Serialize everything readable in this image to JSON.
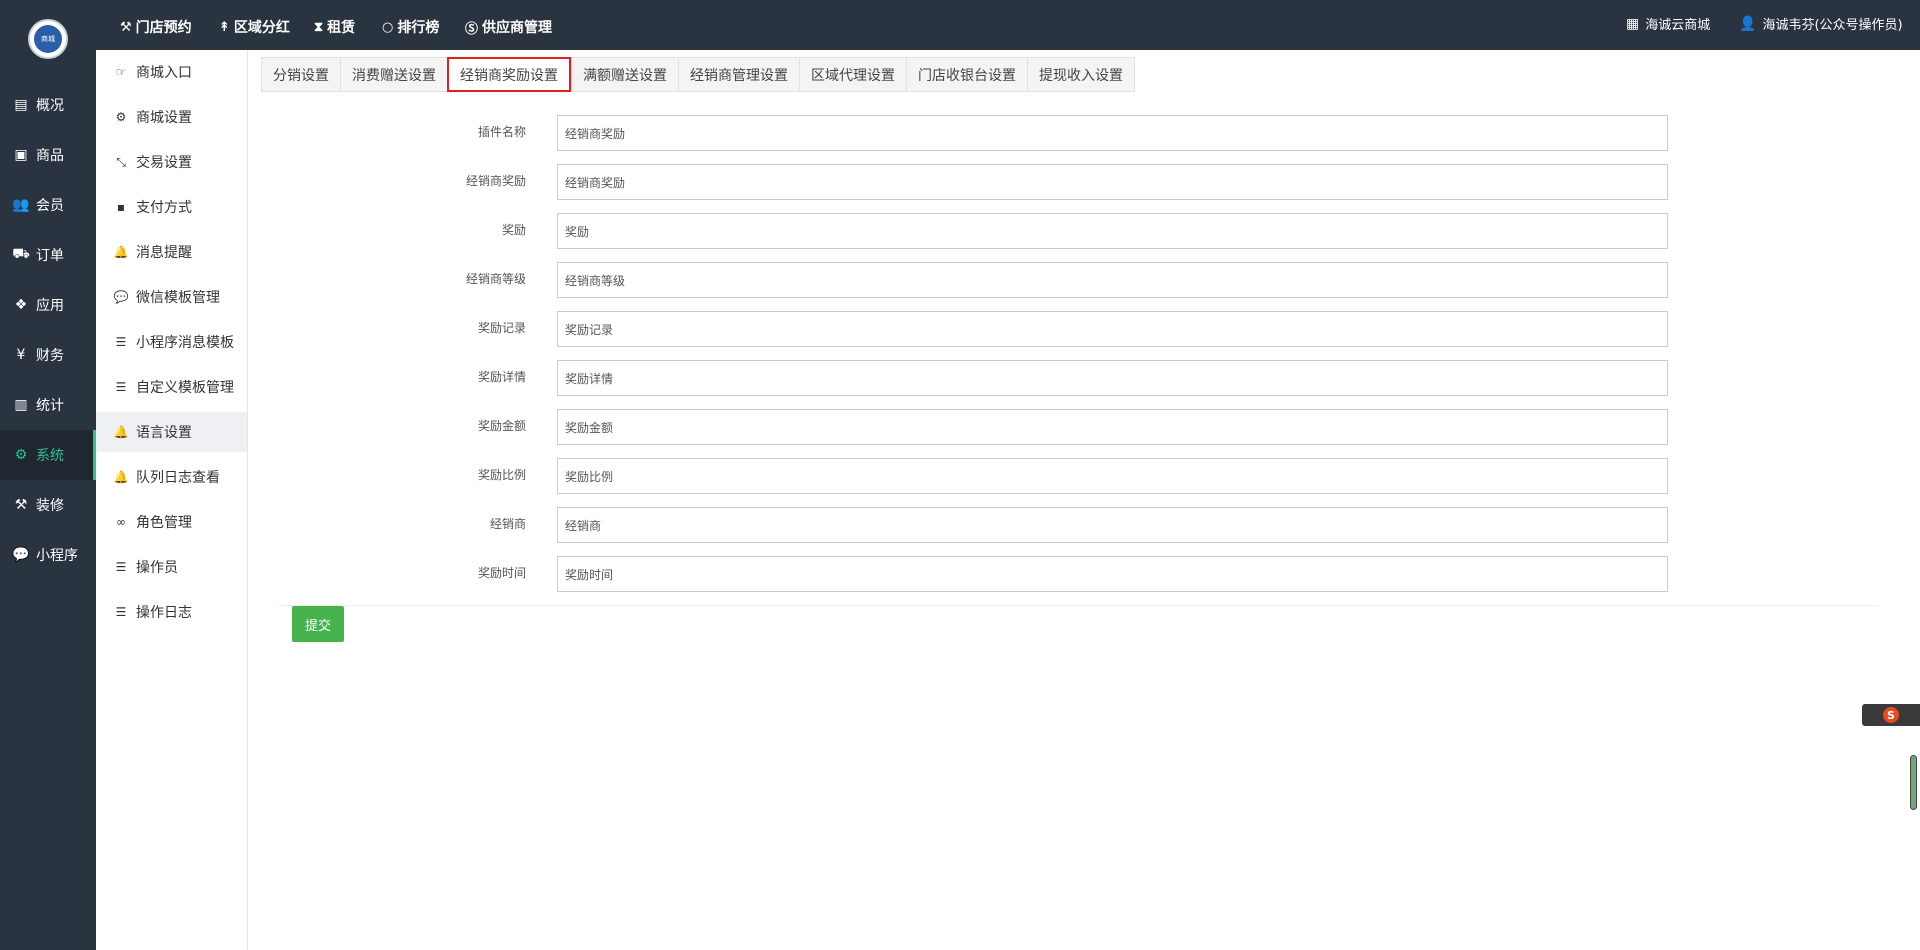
{
  "logo": {
    "text": "商城"
  },
  "sidebar": {
    "items": [
      {
        "label": "概况",
        "icon": "card-icon"
      },
      {
        "label": "商品",
        "icon": "box-icon"
      },
      {
        "label": "会员",
        "icon": "users-icon"
      },
      {
        "label": "订单",
        "icon": "cart-icon"
      },
      {
        "label": "应用",
        "icon": "cubes-icon"
      },
      {
        "label": "财务",
        "icon": "yen-icon"
      },
      {
        "label": "统计",
        "icon": "bar-chart-icon"
      },
      {
        "label": "系统",
        "icon": "gears-icon",
        "active": true
      },
      {
        "label": "装修",
        "icon": "hammer-icon"
      },
      {
        "label": "小程序",
        "icon": "wechat-icon"
      }
    ]
  },
  "topbar": {
    "links": [
      {
        "label": "门店预约",
        "icon": "gavel-icon"
      },
      {
        "label": "区域分红",
        "icon": "pin-icon"
      },
      {
        "label": "租赁",
        "icon": "hourglass-icon"
      },
      {
        "label": "排行榜",
        "icon": "circle-icon"
      },
      {
        "label": "供应商管理",
        "icon": "skype-icon"
      }
    ],
    "store_link": "海诚云商城",
    "user": "海诚韦芬(公众号操作员)"
  },
  "subnav": {
    "items": [
      {
        "label": "商城入口",
        "icon": "hand-pointer-icon"
      },
      {
        "label": "商城设置",
        "icon": "gear-icon"
      },
      {
        "label": "交易设置",
        "icon": "compress-icon"
      },
      {
        "label": "支付方式",
        "icon": "facebook-square-icon"
      },
      {
        "label": "消息提醒",
        "icon": "bell-icon"
      },
      {
        "label": "微信模板管理",
        "icon": "wechat-icon"
      },
      {
        "label": "小程序消息模板",
        "icon": "bars-icon"
      },
      {
        "label": "自定义模板管理",
        "icon": "bars-icon"
      },
      {
        "label": "语言设置",
        "icon": "bell-icon",
        "active": true
      },
      {
        "label": "队列日志查看",
        "icon": "bell-icon"
      },
      {
        "label": "角色管理",
        "icon": "mask-icon"
      },
      {
        "label": "操作员",
        "icon": "list-icon"
      },
      {
        "label": "操作日志",
        "icon": "list-icon"
      }
    ]
  },
  "tabs": [
    {
      "label": "分销设置"
    },
    {
      "label": "消费赠送设置"
    },
    {
      "label": "经销商奖励设置",
      "active": true
    },
    {
      "label": "满额赠送设置"
    },
    {
      "label": "经销商管理设置"
    },
    {
      "label": "区域代理设置"
    },
    {
      "label": "门店收银台设置"
    },
    {
      "label": "提现收入设置"
    }
  ],
  "form": {
    "rows": [
      {
        "label": "插件名称",
        "value": "经销商奖励"
      },
      {
        "label": "经销商奖励",
        "value": "经销商奖励"
      },
      {
        "label": "奖励",
        "value": "奖励"
      },
      {
        "label": "经销商等级",
        "value": "经销商等级"
      },
      {
        "label": "奖励记录",
        "value": "奖励记录"
      },
      {
        "label": "奖励详情",
        "value": "奖励详情"
      },
      {
        "label": "奖励金额",
        "value": "奖励金额"
      },
      {
        "label": "奖励比例",
        "value": "奖励比例"
      },
      {
        "label": "经销商",
        "value": "经销商"
      },
      {
        "label": "奖励时间",
        "value": "奖励时间"
      }
    ],
    "submit_label": "提交"
  },
  "ime": {
    "glyph": "S"
  },
  "colors": {
    "sidebar_bg": "#2a3340",
    "accent": "#30c28f",
    "submit": "#47b34f",
    "active_tab_border": "#e02020"
  }
}
